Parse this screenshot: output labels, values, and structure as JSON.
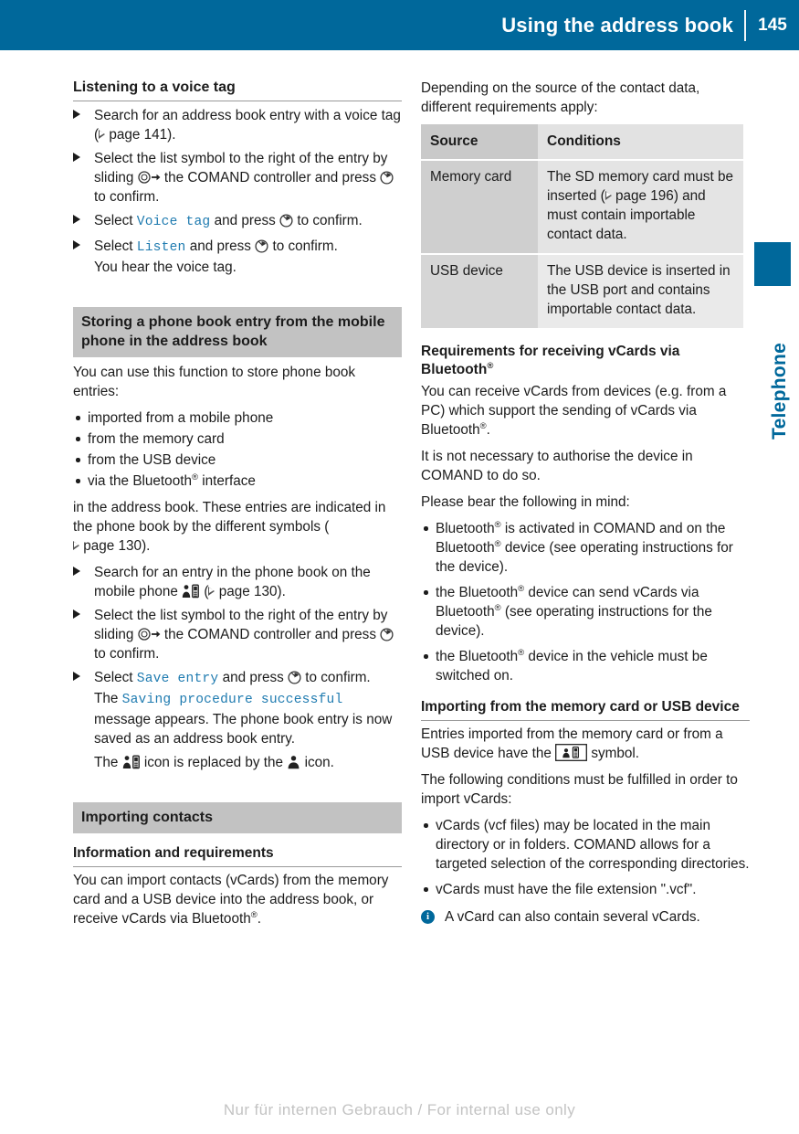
{
  "header": {
    "title": "Using the address book",
    "page_number": "145",
    "accent_color": "#00689b"
  },
  "edge_tab": {
    "label": "Telephone",
    "color": "#00689b"
  },
  "left_column": {
    "section1": {
      "heading": "Listening to a voice tag",
      "steps": [
        {
          "pre": "Search for an address book entry with a voice tag (",
          "ref": "page 141",
          "post": ")."
        },
        {
          "pre": "Select the list symbol to the right of the entry by sliding ",
          "mid": " the COMAND controller and press ",
          "post": " to confirm."
        },
        {
          "pre": "Select ",
          "term": "Voice tag",
          "mid": " and press ",
          "post": " to confirm."
        },
        {
          "pre": "Select ",
          "term": "Listen",
          "mid": " and press ",
          "post": " to confirm.",
          "extra": "You hear the voice tag."
        }
      ]
    },
    "section2": {
      "gray_heading": "Storing a phone book entry from the mobile phone in the address book",
      "intro": "You can use this function to store phone book entries:",
      "bullets": [
        "imported from a mobile phone",
        "from the memory card",
        "from the USB device",
        "via the Bluetooth® interface"
      ],
      "after_bullets_pre": "in the address book. These entries are indicated in the phone book by the different symbols (",
      "after_bullets_ref": "page 130",
      "after_bullets_post": ").",
      "steps": [
        {
          "pre": "Search for an entry in the phone book on the mobile phone ",
          "icon": "person-phone-icon",
          "mid": " (",
          "ref": "page 130",
          "post": ")."
        },
        {
          "pre": "Select the list symbol to the right of the entry by sliding ",
          "mid": " the COMAND controller and press ",
          "post": " to confirm."
        },
        {
          "pre": "Select ",
          "term": "Save entry",
          "mid": " and press ",
          "post": " to confirm.",
          "msg_pre": "The ",
          "msg_term": "Saving procedure successful",
          "msg_post": " message appears. The phone book entry is now saved as an address book entry.",
          "icon_line_pre": "The ",
          "icon_line_mid": " icon is replaced by the ",
          "icon_line_post": " icon."
        }
      ]
    },
    "section3": {
      "gray_heading": "Importing contacts",
      "minihead": "Information and requirements",
      "body": "You can import contacts (vCards) from the memory card and a USB device into the address book, or receive vCards via Bluetooth®."
    }
  },
  "right_column": {
    "intro": "Depending on the source of the contact data, different requirements apply:",
    "table": {
      "type": "table",
      "columns": [
        "Source",
        "Conditions"
      ],
      "rows": [
        {
          "source": "Memory card",
          "condition_pre": "The SD memory card must be inserted (",
          "condition_ref": "page 196",
          "condition_post": ") and must contain importable contact data."
        },
        {
          "source": "USB device",
          "condition_pre": "The USB device is inserted in the USB port and contains importable contact data.",
          "condition_ref": "",
          "condition_post": ""
        }
      ]
    },
    "section_bt": {
      "heading_line1": "Requirements for receiving vCards via",
      "heading_line2_text": "Bluetooth",
      "para1": "You can receive vCards from devices (e.g. from a PC) which support the sending of vCards via Bluetooth®.",
      "para2": "It is not necessary to authorise the device in COMAND to do so.",
      "para3": "Please bear the following in mind:",
      "bullets": [
        "Bluetooth® is activated in COMAND and on the Bluetooth® device (see operating instructions for the device).",
        "the Bluetooth® device can send vCards via Bluetooth® (see operating instructions for the device).",
        "the Bluetooth® device in the vehicle must be switched on."
      ]
    },
    "section_import": {
      "heading": "Importing from the memory card or USB device",
      "para1_pre": "Entries imported from the memory card or from a USB device have the ",
      "para1_icon": "card-contact-icon",
      "para1_post": " symbol.",
      "para2": "The following conditions must be fulfilled in order to import vCards:",
      "bullets": [
        "vCards (vcf files) may be located in the main directory or in folders. COMAND allows for a targeted selection of the corresponding directories.",
        "vCards must have the file extension \".vcf\"."
      ],
      "note": "A vCard can also contain several vCards.",
      "note_icon": "info-icon"
    }
  },
  "footer": {
    "watermark": "Nur für internen Gebrauch / For internal use only"
  }
}
